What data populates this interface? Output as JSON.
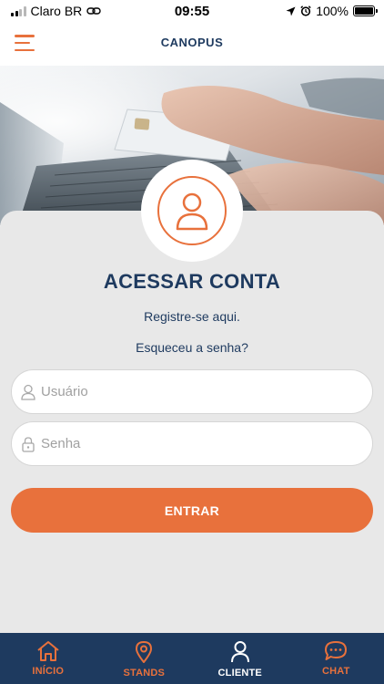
{
  "status_bar": {
    "carrier": "Claro BR",
    "time": "09:55",
    "battery": "100%",
    "battery_level": 1.0
  },
  "header": {
    "title": "CANOPUS",
    "menu_icon": "hamburger-menu-icon"
  },
  "login": {
    "title": "ACESSAR CONTA",
    "register_link": "Registre-se aqui.",
    "forgot_link": "Esqueceu a senha?",
    "username_placeholder": "Usuário",
    "password_placeholder": "Senha",
    "submit_label": "ENTRAR"
  },
  "bottom_nav": {
    "items": [
      {
        "label": "INÍCIO",
        "icon": "home-icon"
      },
      {
        "label": "STANDS",
        "icon": "map-pin-icon"
      },
      {
        "label": "CLIENTE",
        "icon": "user-icon",
        "active": true
      },
      {
        "label": "CHAT",
        "icon": "chat-bubble-icon"
      }
    ]
  },
  "colors": {
    "accent": "#e8713c",
    "navy": "#1e3a5f",
    "card_bg": "#e8e8e8"
  }
}
